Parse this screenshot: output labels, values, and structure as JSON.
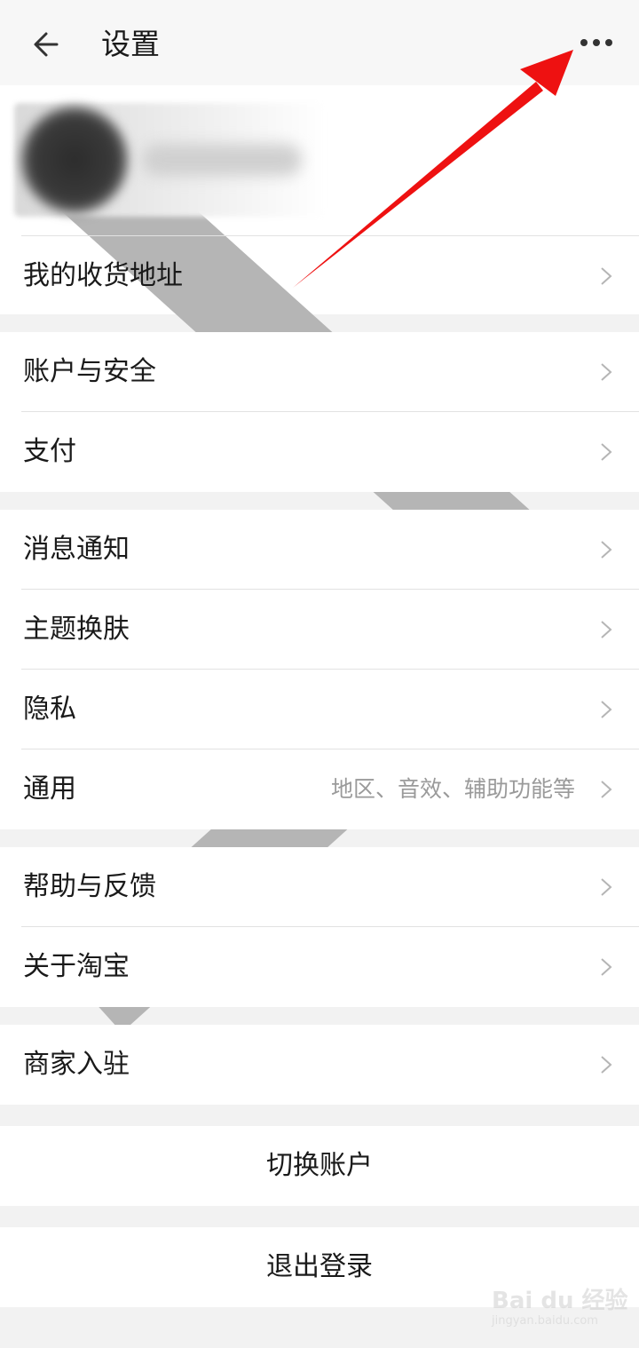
{
  "header": {
    "title": "设置",
    "back_icon": "arrow-left-icon",
    "more_icon": "more-horizontal-icon"
  },
  "profile": {
    "avatar_icon": "avatar-blurred",
    "chevron_icon": "chevron-right-icon"
  },
  "groups": {
    "address": {
      "label": "我的收货地址"
    },
    "account": {
      "label": "账户与安全"
    },
    "payment": {
      "label": "支付"
    },
    "notifications": {
      "label": "消息通知"
    },
    "theme": {
      "label": "主题换肤"
    },
    "privacy": {
      "label": "隐私"
    },
    "general": {
      "label": "通用",
      "hint": "地区、音效、辅助功能等"
    },
    "help": {
      "label": "帮助与反馈"
    },
    "about": {
      "label": "关于淘宝"
    },
    "merchant": {
      "label": "商家入驻"
    }
  },
  "actions": {
    "switch_account": "切换账户",
    "logout": "退出登录"
  },
  "watermark": {
    "main": "Bai du 经验",
    "sub": "jingyan.baidu.com"
  },
  "colors": {
    "background": "#f2f2f2",
    "card": "#ffffff",
    "annotation_arrow": "#ee1111",
    "hint_text": "#9a9a9a"
  }
}
